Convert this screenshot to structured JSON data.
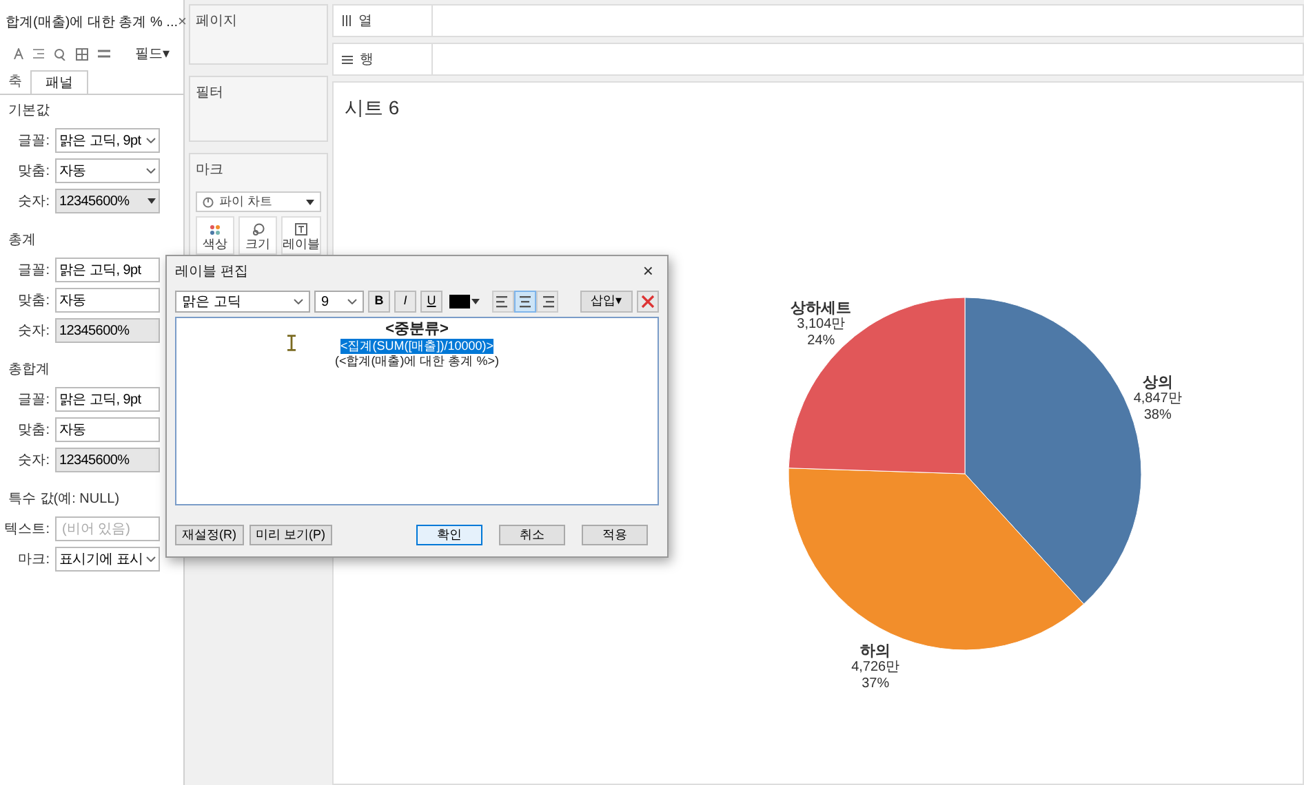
{
  "format_panel": {
    "title": "합계(매출)에 대한 총계 % ...",
    "close": "×",
    "fields_button": "필드▾",
    "tabs": [
      {
        "label": "축",
        "selected": false
      },
      {
        "label": "패널",
        "selected": true
      }
    ],
    "sections": [
      {
        "title": "기본값",
        "rows": [
          {
            "kind": "select",
            "label": "글꼴:",
            "value": "맑은 고딕, 9pt"
          },
          {
            "kind": "select",
            "label": "맞춤:",
            "value": "자동"
          },
          {
            "kind": "number",
            "label": "숫자:",
            "value": "12345600%"
          }
        ]
      },
      {
        "title": "총계",
        "rows": [
          {
            "kind": "select",
            "label": "글꼴:",
            "value": "맑은 고딕, 9pt"
          },
          {
            "kind": "select",
            "label": "맞춤:",
            "value": "자동"
          },
          {
            "kind": "number",
            "label": "숫자:",
            "value": "12345600%"
          }
        ]
      },
      {
        "title": "총합계",
        "rows": [
          {
            "kind": "select",
            "label": "글꼴:",
            "value": "맑은 고딕, 9pt"
          },
          {
            "kind": "select",
            "label": "맞춤:",
            "value": "자동"
          },
          {
            "kind": "number",
            "label": "숫자:",
            "value": "12345600%"
          }
        ]
      },
      {
        "title": "특수 값(예: NULL)",
        "rows": [
          {
            "kind": "text",
            "label": "텍스트:",
            "placeholder": "(비어 있음)"
          },
          {
            "kind": "select",
            "label": "마크:",
            "value": "표시기에 표시"
          }
        ]
      }
    ]
  },
  "cards": {
    "pages": "페이지",
    "filters": "필터",
    "marks": {
      "title": "마크",
      "type": "파이 차트",
      "buttons": [
        "색상",
        "크기",
        "레이블"
      ]
    }
  },
  "shelves": {
    "columns": "열",
    "rows": "행"
  },
  "sheet": {
    "title": "시트 6",
    "chart_data": {
      "type": "pie",
      "categories": [
        "상의",
        "하의",
        "상하세트"
      ],
      "values": [
        4847,
        4726,
        3104
      ],
      "value_labels": [
        "4,847만",
        "4,726만",
        "3,104만"
      ]
    },
    "labels": [
      {
        "percent": "38%",
        "color": "#4e79a7"
      },
      {
        "percent": "37%",
        "color": "#f28e2b"
      },
      {
        "percent": "24%",
        "color": "#e15759"
      }
    ]
  },
  "dialog": {
    "title": "레이블 편집",
    "close": "×",
    "font": "맑은 고딕",
    "size": "9",
    "bold": "B",
    "italic": "I",
    "underline": "U",
    "align": [
      {
        "kind": "left",
        "selected": false
      },
      {
        "kind": "center",
        "selected": true
      },
      {
        "kind": "right",
        "selected": false
      }
    ],
    "insert": "삽입▾",
    "lines": [
      {
        "kind": "heading",
        "text": "<중분류>",
        "selected": false
      },
      {
        "kind": "normal",
        "text": "<집계(SUM([매출])/10000)>",
        "selected": true
      },
      {
        "kind": "normal",
        "text": "(<합계(매출)에 대한 총계 %>)",
        "selected": false
      }
    ],
    "buttons": [
      {
        "label": "재설정(R)",
        "kind": "secondary"
      },
      {
        "label": "미리 보기(P)",
        "kind": "secondary"
      },
      {
        "label": "확인",
        "kind": "primary"
      },
      {
        "label": "취소",
        "kind": "normal"
      },
      {
        "label": "적용",
        "kind": "normal"
      }
    ]
  }
}
